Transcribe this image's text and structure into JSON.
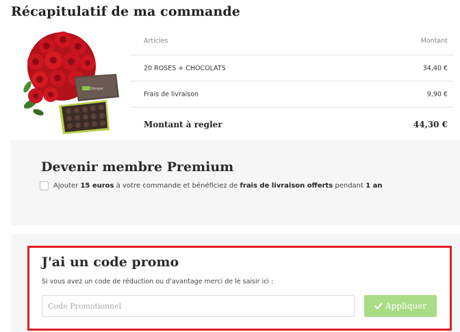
{
  "page": {
    "title": "Récapitulatif de ma commande"
  },
  "summary": {
    "header": {
      "articles": "Articles",
      "montant": "Montant"
    },
    "items": [
      {
        "label": "20 ROSES + CHOCOLATS",
        "amount": "34,40 €"
      },
      {
        "label": "Frais de livraison",
        "amount": "9,90 €"
      }
    ],
    "total": {
      "label": "Montant à regler",
      "amount": "44,30 €"
    }
  },
  "product_image": {
    "box_brand": "florajet"
  },
  "premium": {
    "title": "Devenir membre Premium",
    "text_1": "Ajouter",
    "bold_1": "15 euros",
    "text_2": "à votre commande et bénéficiez de",
    "bold_2": "frais de livraison offerts",
    "text_3": "pendant",
    "bold_3": "1 an",
    "checked": false
  },
  "promo": {
    "title": "J'ai un code promo",
    "subtitle": "Si vous avez un code de réduction ou d'avantage merci de le saisir ici :",
    "placeholder": "Code Promotionnel",
    "value": "",
    "button_label": "Appliquer",
    "button_icon": "check-icon"
  },
  "colors": {
    "highlight_border": "#e01e26",
    "button_green": "#a9dc84",
    "panel_bg": "#f6f6f6"
  }
}
